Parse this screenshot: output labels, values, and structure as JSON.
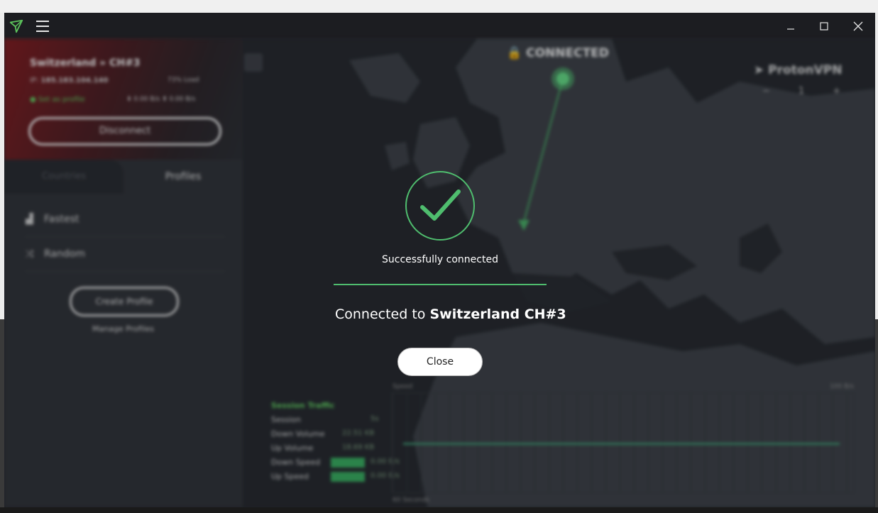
{
  "window": {
    "title_icon": "protonvpn-logo-icon",
    "menu_icon": "hamburger-menu-icon",
    "controls": {
      "minimize": "_",
      "maximize": "☐",
      "close": "✕"
    }
  },
  "sidebar": {
    "server_name": "Switzerland » CH#3",
    "ip_label": "IP:",
    "ip_value": "185.183.104.140",
    "load_label": "73% Load",
    "profile_link": "Set as profile",
    "down_speed": "0.00 B/s",
    "up_speed": "0.00 B/s",
    "disconnect_label": "Disconnect",
    "tabs": [
      "Countries",
      "Profiles"
    ],
    "profiles": [
      {
        "icon": "signal-bars-icon",
        "label": "Fastest"
      },
      {
        "icon": "shuffle-icon",
        "label": "Random"
      }
    ],
    "create_profile_label": "Create Profile",
    "manage_profiles_label": "Manage Profiles"
  },
  "map": {
    "status": "CONNECTED",
    "brand": "ProtonVPN",
    "zoom_minus": "−",
    "zoom_level": "1",
    "zoom_plus": "+"
  },
  "traffic": {
    "title": "Session Traffic",
    "rows": [
      {
        "label": "Session",
        "value": "5s"
      },
      {
        "label": "Down Volume",
        "value": "22.51 KB"
      },
      {
        "label": "Up Volume",
        "value": "18.69 KB"
      },
      {
        "label": "Down Speed",
        "value": "0.00 B/s"
      },
      {
        "label": "Up Speed",
        "value": "0.00 B/s"
      }
    ],
    "graph_top_left": "Speed",
    "graph_top_right": "100 B/s",
    "graph_bottom_left": "60 Seconds"
  },
  "modal": {
    "success_text": "Successfully connected",
    "connected_prefix": "Connected to",
    "server": "Switzerland CH#3",
    "close_label": "Close",
    "accent": "#4fbd6e"
  }
}
